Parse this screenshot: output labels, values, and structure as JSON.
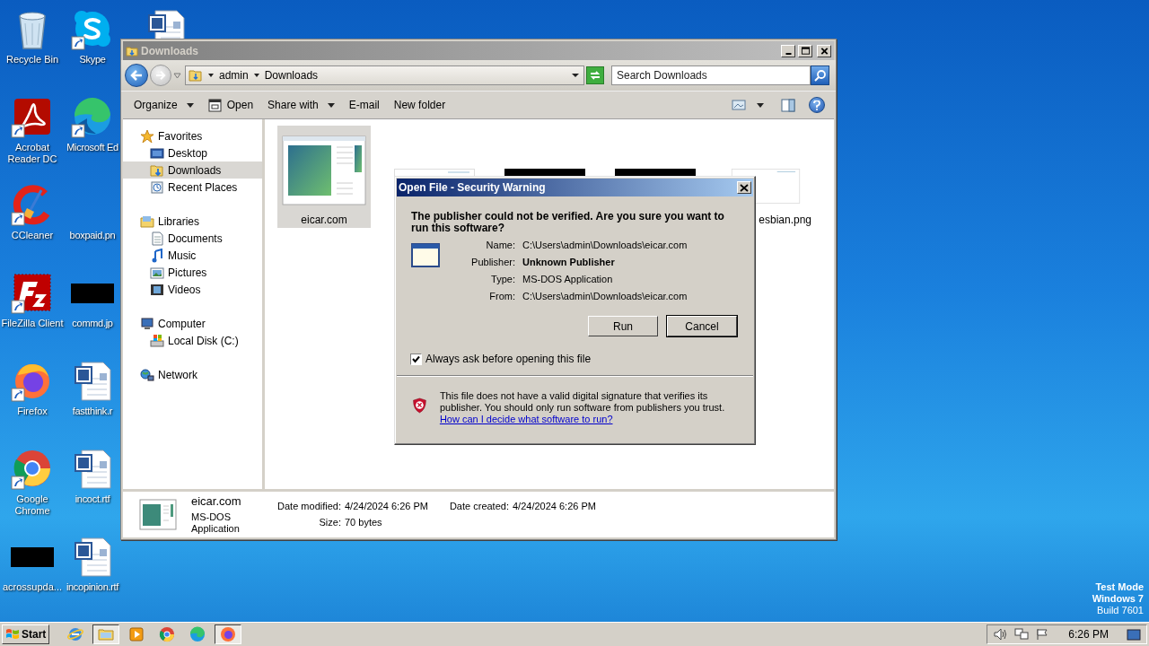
{
  "desktop_columns": [
    [
      {
        "label": "Recycle Bin",
        "kind": "recycle",
        "shortcut": false
      },
      {
        "label": "Acrobat Reader DC",
        "kind": "acrobat",
        "shortcut": true
      },
      {
        "label": "CCleaner",
        "kind": "ccleaner",
        "shortcut": true
      },
      {
        "label": "FileZilla Client",
        "kind": "filezilla",
        "shortcut": true
      },
      {
        "label": "Firefox",
        "kind": "firefox",
        "shortcut": true
      },
      {
        "label": "Google Chrome",
        "kind": "chrome",
        "shortcut": true
      },
      {
        "label": "acrossupda...",
        "kind": "redacted",
        "shortcut": false
      }
    ],
    [
      {
        "label": "Skype",
        "kind": "skype",
        "shortcut": true
      },
      {
        "label": "Microsoft Ed",
        "kind": "edge",
        "shortcut": true
      },
      {
        "label": "boxpaid.pn"
      },
      {
        "label": "commd.jp",
        "kind": "redacted",
        "shortcut": false
      },
      {
        "label": "fastthink.r",
        "kind": "word",
        "shortcut": false
      },
      {
        "label": "incoct.rtf",
        "kind": "word",
        "shortcut": false
      },
      {
        "label": "incopinion.rtf",
        "kind": "word",
        "shortcut": false
      }
    ],
    [
      {
        "kind": "word",
        "shortcut": false
      }
    ]
  ],
  "explorer": {
    "title": "Downloads",
    "breadcrumb": [
      "admin",
      "Downloads"
    ],
    "search": {
      "placeholder": "Search Downloads"
    },
    "toolbar": [
      {
        "label": "Organize",
        "kind": "dropdown"
      },
      {
        "label": "Open",
        "kind": "open"
      },
      {
        "label": "Share with",
        "kind": "dropdown"
      },
      {
        "label": "E-mail",
        "kind": "plain"
      },
      {
        "label": "New folder",
        "kind": "plain"
      }
    ],
    "nav": [
      {
        "label": "Favorites",
        "kind": "star",
        "selected": false,
        "children": [
          {
            "label": "Desktop",
            "kind": "desktop",
            "selected": false
          },
          {
            "label": "Downloads",
            "kind": "downloads",
            "selected": true
          },
          {
            "label": "Recent Places",
            "kind": "recent",
            "selected": false
          }
        ]
      },
      {
        "label": "Libraries",
        "kind": "libraries",
        "selected": false,
        "children": [
          {
            "label": "Documents",
            "kind": "documents",
            "selected": false
          },
          {
            "label": "Music",
            "kind": "music",
            "selected": false
          },
          {
            "label": "Pictures",
            "kind": "pictures",
            "selected": false
          },
          {
            "label": "Videos",
            "kind": "videos",
            "selected": false
          }
        ]
      },
      {
        "label": "Computer",
        "kind": "computer",
        "selected": false,
        "children": [
          {
            "label": "Local Disk (C:)",
            "kind": "disk",
            "selected": false
          }
        ]
      },
      {
        "label": "Network",
        "kind": "network",
        "selected": false
      }
    ],
    "files": [
      {
        "label": "eicar.com",
        "kind": "app",
        "selected": true
      },
      {
        "kind": "image",
        "selected": false
      },
      {
        "kind": "redacted",
        "selected": false
      },
      {
        "kind": "redacted",
        "selected": false
      },
      {
        "label": "esbian.png",
        "kind": "image",
        "selected": false
      }
    ],
    "details": {
      "name": "eicar.com",
      "type": "MS-DOS Application",
      "fields": [
        {
          "label": "Date modified:",
          "value": "4/24/2024 6:26 PM"
        },
        {
          "label": "Size:",
          "value": "70 bytes"
        },
        {
          "label": "Date created:",
          "value": "4/24/2024 6:26 PM"
        }
      ]
    }
  },
  "dialog": {
    "title": "Open File - Security Warning",
    "heading": "The publisher could not be verified.  Are you sure you want to run this software?",
    "fields": [
      {
        "label": "Name:",
        "value": "C:\\Users\\admin\\Downloads\\eicar.com",
        "emphasis": false
      },
      {
        "label": "Publisher:",
        "value": "Unknown Publisher",
        "emphasis": true
      },
      {
        "label": "Type:",
        "value": "MS-DOS Application",
        "emphasis": false
      },
      {
        "label": "From:",
        "value": "C:\\Users\\admin\\Downloads\\eicar.com",
        "emphasis": false
      }
    ],
    "buttons": [
      "Run",
      "Cancel"
    ],
    "checkbox": {
      "label": "Always ask before opening this file",
      "checked": true
    },
    "warning": "This file does not have a valid digital signature that verifies its publisher.  You should only run software from publishers you trust.",
    "link": "How can I decide what software to run?"
  },
  "taskbar": {
    "start": "Start",
    "apps": [
      {
        "kind": "ie",
        "selected": false
      },
      {
        "kind": "explorer",
        "selected": true
      },
      {
        "kind": "media",
        "selected": false
      },
      {
        "kind": "chrome",
        "selected": false
      },
      {
        "kind": "edge",
        "selected": false
      },
      {
        "kind": "firefox",
        "selected": true
      }
    ],
    "time": "6:26 PM"
  },
  "os_notice": [
    "Test Mode",
    "Windows 7",
    "Build 7601"
  ]
}
